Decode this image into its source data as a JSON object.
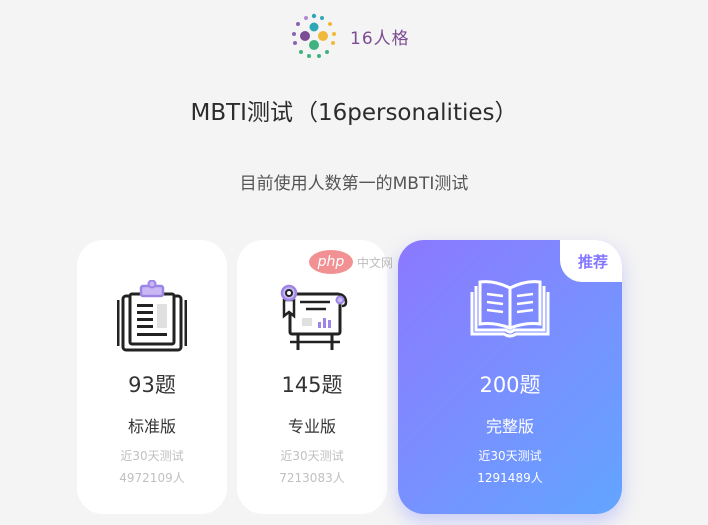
{
  "brand": {
    "name": "16人格"
  },
  "header": {
    "title_main": "MBTI测试",
    "title_paren": "（16personalities）",
    "subtitle": "目前使用人数第一的MBTI测试"
  },
  "cards": [
    {
      "count": "93题",
      "edition": "标准版",
      "stat_label": "近30天测试",
      "stat_value": "4972109人",
      "icon": "clipboard-icon"
    },
    {
      "count": "145题",
      "edition": "专业版",
      "stat_label": "近30天测试",
      "stat_value": "7213083人",
      "icon": "certificate-icon"
    },
    {
      "count": "200题",
      "edition": "完整版",
      "stat_label": "近30天测试",
      "stat_value": "1291489人",
      "icon": "open-book-icon",
      "badge": "推荐"
    }
  ],
  "watermark": {
    "logo": "php",
    "text": "中文网"
  },
  "colors": {
    "brand_purple": "#7b4c93",
    "accent_gradient_start": "#8b78ff",
    "accent_gradient_end": "#62a5ff",
    "badge_text": "#8578ff"
  }
}
